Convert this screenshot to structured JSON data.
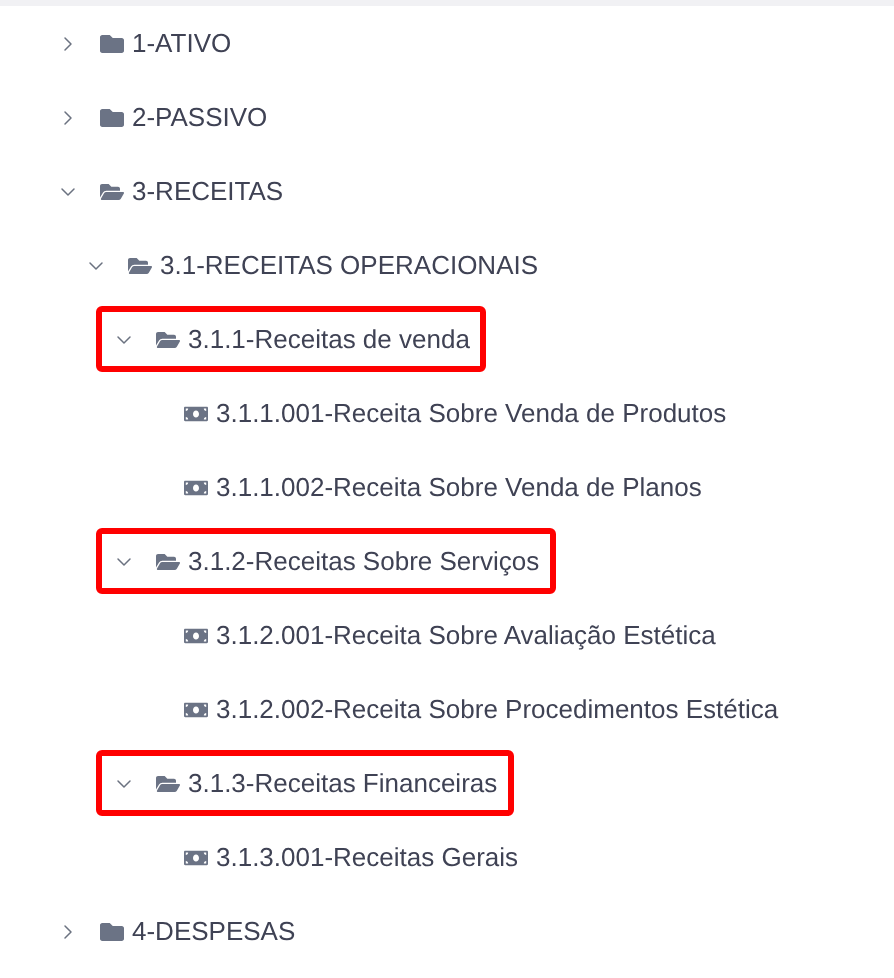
{
  "tree": [
    {
      "kind": "group",
      "label": "1-ATIVO",
      "expanded": false,
      "highlighted": false
    },
    {
      "kind": "group",
      "label": "2-PASSIVO",
      "expanded": false,
      "highlighted": false
    },
    {
      "kind": "group",
      "label": "3-RECEITAS",
      "expanded": true,
      "highlighted": false,
      "children": [
        {
          "kind": "group",
          "label": "3.1-RECEITAS OPERACIONAIS",
          "expanded": true,
          "highlighted": false,
          "children": [
            {
              "kind": "group",
              "label": "3.1.1-Receitas de venda",
              "expanded": true,
              "highlighted": true,
              "children": [
                {
                  "kind": "account",
                  "label": "3.1.1.001-Receita Sobre Venda de Produtos",
                  "highlighted": false
                },
                {
                  "kind": "account",
                  "label": "3.1.1.002-Receita Sobre Venda de Planos",
                  "highlighted": false
                }
              ]
            },
            {
              "kind": "group",
              "label": "3.1.2-Receitas Sobre Serviços",
              "expanded": true,
              "highlighted": true,
              "children": [
                {
                  "kind": "account",
                  "label": "3.1.2.001-Receita Sobre Avaliação Estética",
                  "highlighted": false
                },
                {
                  "kind": "account",
                  "label": "3.1.2.002-Receita Sobre Procedimentos Estética",
                  "highlighted": false
                }
              ]
            },
            {
              "kind": "group",
              "label": "3.1.3-Receitas Financeiras",
              "expanded": true,
              "highlighted": true,
              "children": [
                {
                  "kind": "account",
                  "label": "3.1.3.001-Receitas Gerais",
                  "highlighted": false
                }
              ]
            }
          ]
        }
      ]
    },
    {
      "kind": "group",
      "label": "4-DESPESAS",
      "expanded": false,
      "highlighted": false
    }
  ]
}
